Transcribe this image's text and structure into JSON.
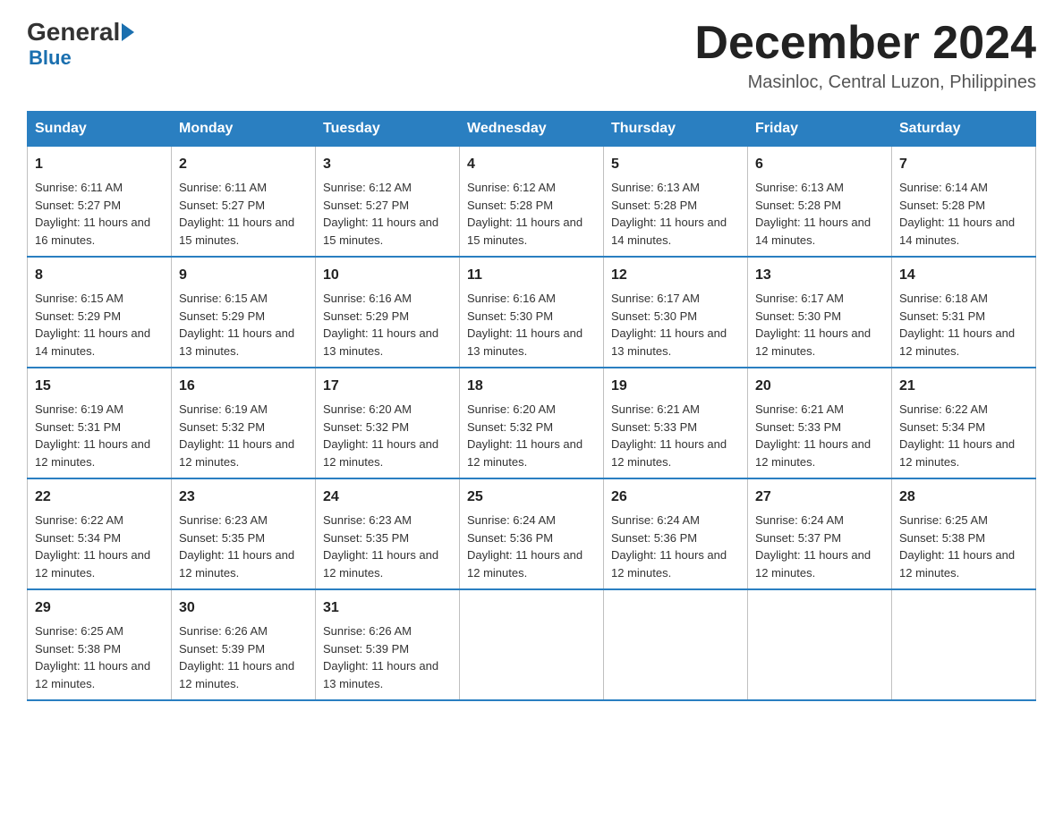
{
  "logo": {
    "general": "General",
    "blue": "Blue",
    "subtitle": "Blue"
  },
  "header": {
    "month": "December 2024",
    "location": "Masinloc, Central Luzon, Philippines"
  },
  "days": [
    "Sunday",
    "Monday",
    "Tuesday",
    "Wednesday",
    "Thursday",
    "Friday",
    "Saturday"
  ],
  "weeks": [
    [
      {
        "num": "1",
        "sunrise": "6:11 AM",
        "sunset": "5:27 PM",
        "daylight": "11 hours and 16 minutes."
      },
      {
        "num": "2",
        "sunrise": "6:11 AM",
        "sunset": "5:27 PM",
        "daylight": "11 hours and 15 minutes."
      },
      {
        "num": "3",
        "sunrise": "6:12 AM",
        "sunset": "5:27 PM",
        "daylight": "11 hours and 15 minutes."
      },
      {
        "num": "4",
        "sunrise": "6:12 AM",
        "sunset": "5:28 PM",
        "daylight": "11 hours and 15 minutes."
      },
      {
        "num": "5",
        "sunrise": "6:13 AM",
        "sunset": "5:28 PM",
        "daylight": "11 hours and 14 minutes."
      },
      {
        "num": "6",
        "sunrise": "6:13 AM",
        "sunset": "5:28 PM",
        "daylight": "11 hours and 14 minutes."
      },
      {
        "num": "7",
        "sunrise": "6:14 AM",
        "sunset": "5:28 PM",
        "daylight": "11 hours and 14 minutes."
      }
    ],
    [
      {
        "num": "8",
        "sunrise": "6:15 AM",
        "sunset": "5:29 PM",
        "daylight": "11 hours and 14 minutes."
      },
      {
        "num": "9",
        "sunrise": "6:15 AM",
        "sunset": "5:29 PM",
        "daylight": "11 hours and 13 minutes."
      },
      {
        "num": "10",
        "sunrise": "6:16 AM",
        "sunset": "5:29 PM",
        "daylight": "11 hours and 13 minutes."
      },
      {
        "num": "11",
        "sunrise": "6:16 AM",
        "sunset": "5:30 PM",
        "daylight": "11 hours and 13 minutes."
      },
      {
        "num": "12",
        "sunrise": "6:17 AM",
        "sunset": "5:30 PM",
        "daylight": "11 hours and 13 minutes."
      },
      {
        "num": "13",
        "sunrise": "6:17 AM",
        "sunset": "5:30 PM",
        "daylight": "11 hours and 12 minutes."
      },
      {
        "num": "14",
        "sunrise": "6:18 AM",
        "sunset": "5:31 PM",
        "daylight": "11 hours and 12 minutes."
      }
    ],
    [
      {
        "num": "15",
        "sunrise": "6:19 AM",
        "sunset": "5:31 PM",
        "daylight": "11 hours and 12 minutes."
      },
      {
        "num": "16",
        "sunrise": "6:19 AM",
        "sunset": "5:32 PM",
        "daylight": "11 hours and 12 minutes."
      },
      {
        "num": "17",
        "sunrise": "6:20 AM",
        "sunset": "5:32 PM",
        "daylight": "11 hours and 12 minutes."
      },
      {
        "num": "18",
        "sunrise": "6:20 AM",
        "sunset": "5:32 PM",
        "daylight": "11 hours and 12 minutes."
      },
      {
        "num": "19",
        "sunrise": "6:21 AM",
        "sunset": "5:33 PM",
        "daylight": "11 hours and 12 minutes."
      },
      {
        "num": "20",
        "sunrise": "6:21 AM",
        "sunset": "5:33 PM",
        "daylight": "11 hours and 12 minutes."
      },
      {
        "num": "21",
        "sunrise": "6:22 AM",
        "sunset": "5:34 PM",
        "daylight": "11 hours and 12 minutes."
      }
    ],
    [
      {
        "num": "22",
        "sunrise": "6:22 AM",
        "sunset": "5:34 PM",
        "daylight": "11 hours and 12 minutes."
      },
      {
        "num": "23",
        "sunrise": "6:23 AM",
        "sunset": "5:35 PM",
        "daylight": "11 hours and 12 minutes."
      },
      {
        "num": "24",
        "sunrise": "6:23 AM",
        "sunset": "5:35 PM",
        "daylight": "11 hours and 12 minutes."
      },
      {
        "num": "25",
        "sunrise": "6:24 AM",
        "sunset": "5:36 PM",
        "daylight": "11 hours and 12 minutes."
      },
      {
        "num": "26",
        "sunrise": "6:24 AM",
        "sunset": "5:36 PM",
        "daylight": "11 hours and 12 minutes."
      },
      {
        "num": "27",
        "sunrise": "6:24 AM",
        "sunset": "5:37 PM",
        "daylight": "11 hours and 12 minutes."
      },
      {
        "num": "28",
        "sunrise": "6:25 AM",
        "sunset": "5:38 PM",
        "daylight": "11 hours and 12 minutes."
      }
    ],
    [
      {
        "num": "29",
        "sunrise": "6:25 AM",
        "sunset": "5:38 PM",
        "daylight": "11 hours and 12 minutes."
      },
      {
        "num": "30",
        "sunrise": "6:26 AM",
        "sunset": "5:39 PM",
        "daylight": "11 hours and 12 minutes."
      },
      {
        "num": "31",
        "sunrise": "6:26 AM",
        "sunset": "5:39 PM",
        "daylight": "11 hours and 13 minutes."
      },
      null,
      null,
      null,
      null
    ]
  ]
}
